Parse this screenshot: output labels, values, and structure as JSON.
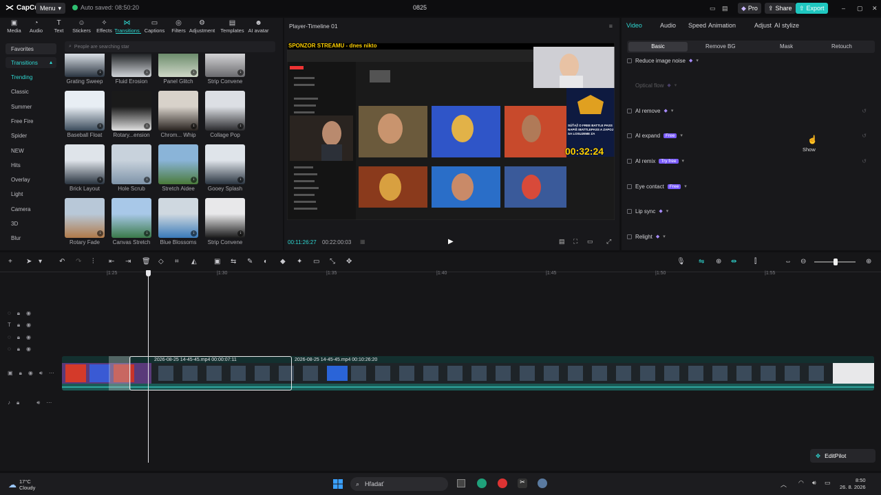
{
  "app": {
    "name": "CapCut",
    "menu_label": "Menu",
    "autosave_text": "Auto saved: 08:50:20",
    "project_title": "0825",
    "pro_label": "Pro",
    "share_label": "Share",
    "export_label": "Export"
  },
  "toolbar_tabs": [
    {
      "label": "Media",
      "icon": "media-icon"
    },
    {
      "label": "Audio",
      "icon": "audio-icon"
    },
    {
      "label": "Text",
      "icon": "text-icon"
    },
    {
      "label": "Stickers",
      "icon": "stickers-icon"
    },
    {
      "label": "Effects",
      "icon": "effects-icon"
    },
    {
      "label": "Transitions",
      "icon": "transitions-icon",
      "active": true
    },
    {
      "label": "Captions",
      "icon": "captions-icon"
    },
    {
      "label": "Filters",
      "icon": "filters-icon"
    },
    {
      "label": "Adjustment",
      "icon": "adjustment-icon"
    },
    {
      "label": "Templates",
      "icon": "templates-icon"
    },
    {
      "label": "AI avatar",
      "icon": "ai-avatar-icon"
    }
  ],
  "sidebar": {
    "favorites": "Favorites",
    "transitions": "Transitions",
    "categories": [
      "Trending",
      "Classic",
      "Summer",
      "Free Fire",
      "Spider",
      "NEW",
      "Hits",
      "Overlay",
      "Light",
      "Camera",
      "3D",
      "Blur"
    ]
  },
  "search": {
    "placeholder": "People are searching star"
  },
  "transitions_grid": [
    {
      "label": "Grating Sweep"
    },
    {
      "label": "Fluid Erosion"
    },
    {
      "label": "Panel Glitch"
    },
    {
      "label": "Strip Convene"
    },
    {
      "label": "Baseball Float"
    },
    {
      "label": "Rotary...ension"
    },
    {
      "label": "Chrom... Whip"
    },
    {
      "label": "Collage Pop"
    },
    {
      "label": "Brick Layout"
    },
    {
      "label": "Hole Scrub"
    },
    {
      "label": "Stretch Aidee"
    },
    {
      "label": "Gooey Splash"
    },
    {
      "label": "Rotary Fade"
    },
    {
      "label": "Canvas Stretch"
    },
    {
      "label": "Blue Blossoms"
    },
    {
      "label": "Strip Convene"
    }
  ],
  "player": {
    "title": "Player-Timeline 01",
    "current_time": "00:11:26:27",
    "total_time": "00:22:00:03",
    "overlay_banner": "SPONZOR STREAMU - dnes nikto",
    "overlay_timer": "00:32:24",
    "overlay_promo": "SÚŤAŽ O FREE BATTLE PASS NAPIŠ !BATTLEPASS A ZAPOJ SA LOSUJEME ZA"
  },
  "props": {
    "tabs": [
      "Video",
      "Audio",
      "Speed",
      "Animation",
      "Adjust",
      "AI stylize"
    ],
    "active_tab": "Video",
    "subtabs": [
      "Basic",
      "Remove BG",
      "Mask",
      "Retouch"
    ],
    "rows": [
      {
        "label": "Reduce image noise",
        "gem": true,
        "badge": ""
      },
      {
        "label": "Optical flow",
        "gem": true,
        "badge": "",
        "dim": true
      },
      {
        "label": "AI remove",
        "gem": true,
        "badge": ""
      },
      {
        "label": "AI expand",
        "gem": false,
        "badge": "Free"
      },
      {
        "label": "AI remix",
        "gem": false,
        "badge": "Try free"
      },
      {
        "label": "Eye contact",
        "gem": false,
        "badge": "Free"
      },
      {
        "label": "Lip sync",
        "gem": true,
        "badge": ""
      },
      {
        "label": "Relight",
        "gem": true,
        "badge": ""
      }
    ],
    "tooltip": "Show"
  },
  "timeline": {
    "ruler": [
      "|1:25",
      "|1:30",
      "|1:35",
      "|1:40",
      "|1:45",
      "|1:50",
      "|1:55"
    ],
    "clip1_label": "2026-08-25 14-45-45.mp4   00:00:07:11",
    "clip2_label": "2026-08-25 14-45-45.mp4   00:10:26:20"
  },
  "editpilot_label": "EditPilot",
  "taskbar": {
    "weather_temp": "17°C",
    "weather_desc": "Cloudy",
    "search_placeholder": "Hľadať",
    "clock_time": "8:50",
    "clock_date": "26. 8. 2026"
  },
  "colors": {
    "accent": "#2fd8d2",
    "panel": "#18181b",
    "export": "#1fc7c0",
    "premium": "#a88cff"
  }
}
